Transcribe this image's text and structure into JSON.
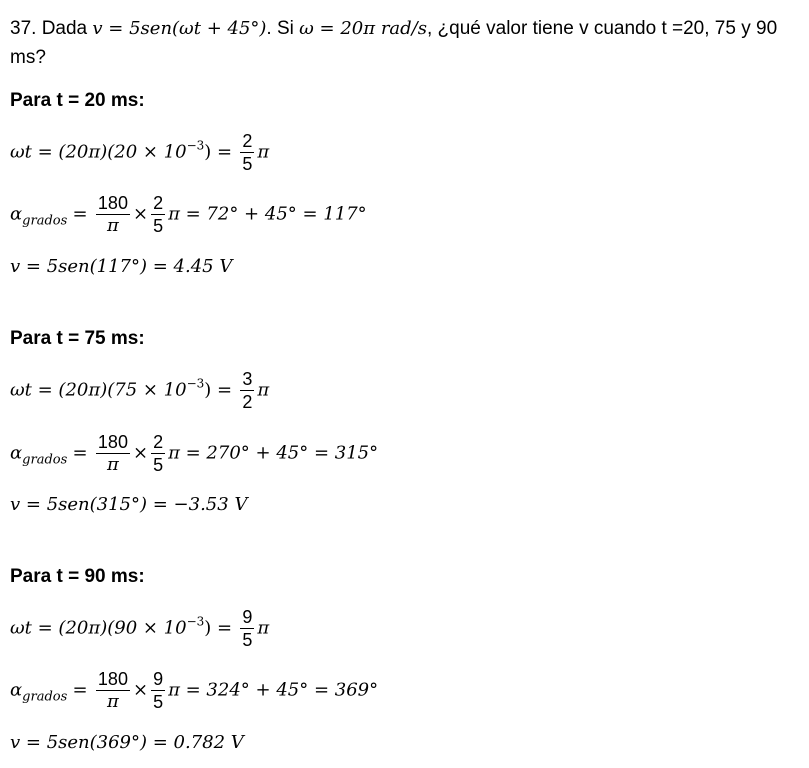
{
  "problem": {
    "number": "37.",
    "text_a": "Dada",
    "expr_v": "v = 5sen(ωt + 45°)",
    "text_b": ". Si",
    "expr_omega": "ω = 20π rad/s",
    "text_c": ", ¿qué valor tiene v cuando t =20, 75 y 90 ms?"
  },
  "sections": [
    {
      "heading": "Para t = 20 ms:",
      "wt_lhs": "ωt = (20π)(20 × 10",
      "wt_exp": "−3",
      "wt_mid": ") =",
      "wt_num": "2",
      "wt_den": "5",
      "wt_tail": "π",
      "alpha_sym": "α",
      "alpha_sub": "grados",
      "alpha_eq": "=",
      "alpha_num": "180",
      "alpha_den": "π",
      "alpha_times": "×",
      "alpha_num2": "2",
      "alpha_den2": "5",
      "alpha_rhs": "π = 72° + 45° = 117°",
      "v_line": "v = 5sen(117°) = 4.45 V"
    },
    {
      "heading": "Para t = 75 ms:",
      "wt_lhs": "ωt = (20π)(75 × 10",
      "wt_exp": "−3",
      "wt_mid": ") =",
      "wt_num": "3",
      "wt_den": "2",
      "wt_tail": "π",
      "alpha_sym": "α",
      "alpha_sub": "grados",
      "alpha_eq": "=",
      "alpha_num": "180",
      "alpha_den": "π",
      "alpha_times": "×",
      "alpha_num2": "2",
      "alpha_den2": "5",
      "alpha_rhs": "π = 270° + 45° = 315°",
      "v_line": "v = 5sen(315°) = −3.53 V"
    },
    {
      "heading": "Para t = 90 ms:",
      "wt_lhs": "ωt = (20π)(90 × 10",
      "wt_exp": "−3",
      "wt_mid": ") =",
      "wt_num": "9",
      "wt_den": "5",
      "wt_tail": "π",
      "alpha_sym": "α",
      "alpha_sub": "grados",
      "alpha_eq": "=",
      "alpha_num": "180",
      "alpha_den": "π",
      "alpha_times": "×",
      "alpha_num2": "9",
      "alpha_den2": "5",
      "alpha_rhs": "π  = 324° + 45° = 369°",
      "v_line": "v = 5sen(369°) = 0.782 V"
    }
  ]
}
